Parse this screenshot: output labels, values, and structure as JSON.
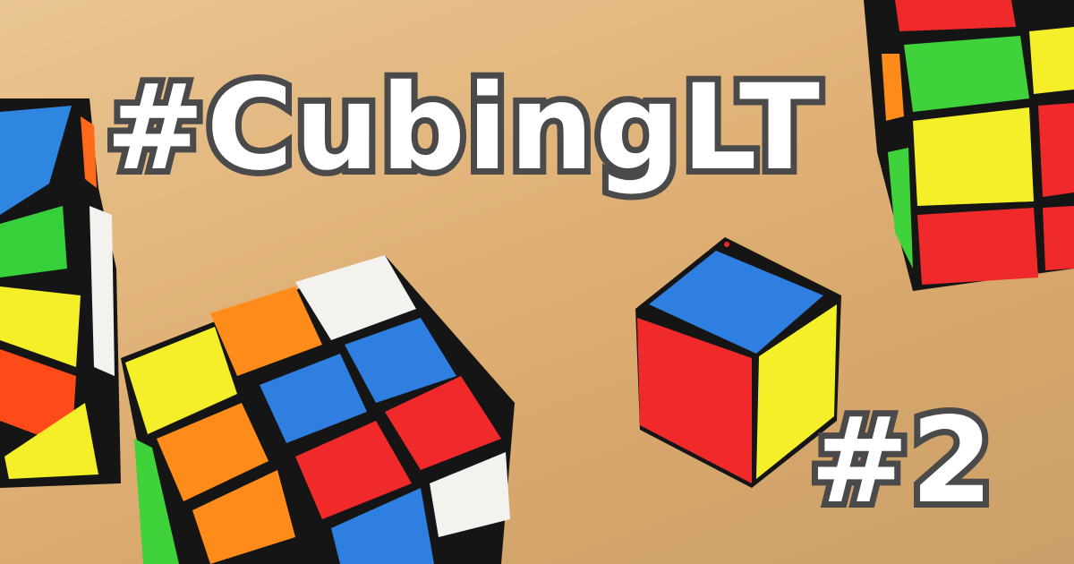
{
  "title": "#CubingLT",
  "episode": "#2",
  "colors": {
    "text_fill": "#ffffff",
    "text_outline": "#4a4a4a",
    "wood": "#e2b57c",
    "cube_blue": "#2f7fe0",
    "cube_red": "#f02a2a",
    "cube_orange": "#ff8c1a",
    "cube_yellow": "#f5ef2a",
    "cube_green": "#3fd23a",
    "cube_white": "#f2f2ee",
    "cube_body_black": "#151515"
  }
}
